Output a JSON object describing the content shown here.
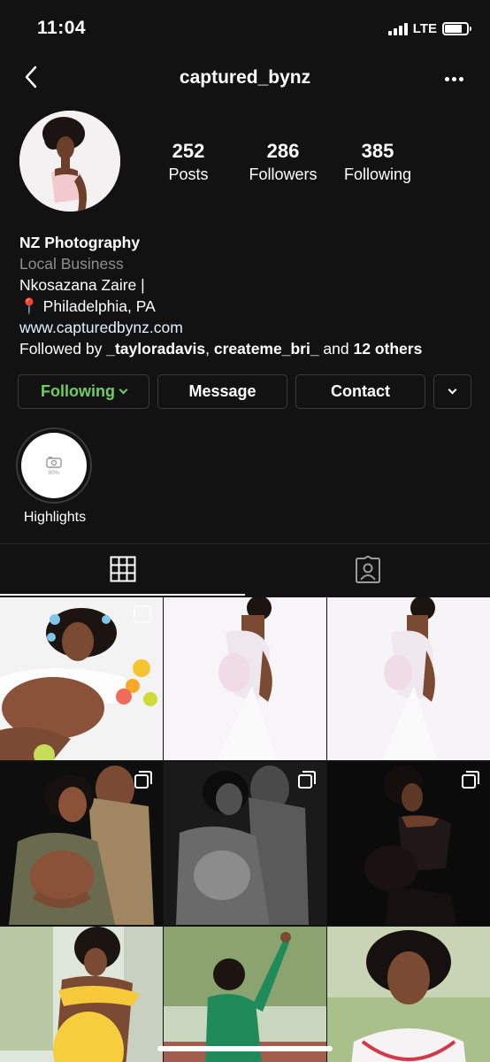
{
  "status_bar": {
    "time": "11:04",
    "network": "LTE"
  },
  "header": {
    "username": "captured_bynz"
  },
  "stats": [
    {
      "value": "252",
      "label": "Posts"
    },
    {
      "value": "286",
      "label": "Followers"
    },
    {
      "value": "385",
      "label": "Following"
    }
  ],
  "bio": {
    "name": "NZ Photography",
    "category": "Local Business",
    "line1": "Nkosazana Zaire |",
    "location_pin": "📍",
    "location": "Philadelphia, PA",
    "website": "www.capturedbynz.com",
    "followed_by_prefix": "Followed by ",
    "followed_user_1": "_tayloradavis",
    "followed_sep": ", ",
    "followed_user_2": "createme_bri_",
    "followed_and": " and ",
    "followed_others": "12 others"
  },
  "buttons": {
    "following": "Following",
    "message": "Message",
    "contact": "Contact"
  },
  "highlights": [
    {
      "label": "Highlights",
      "icon_text": "80%"
    }
  ],
  "tabs": [
    {
      "icon": "grid-icon",
      "active": true
    },
    {
      "icon": "tagged-icon",
      "active": false
    }
  ],
  "grid_posts": [
    {
      "subject": "maternity bath with flowers",
      "multiple": true
    },
    {
      "subject": "maternity white gown",
      "multiple": false
    },
    {
      "subject": "maternity white gown side",
      "multiple": false
    },
    {
      "subject": "couple in military uniform",
      "multiple": true
    },
    {
      "subject": "couple black and white",
      "multiple": true
    },
    {
      "subject": "maternity black dress",
      "multiple": true
    },
    {
      "subject": "maternity yellow dress outdoors",
      "multiple": false
    },
    {
      "subject": "green jacket raised fist",
      "multiple": false
    },
    {
      "subject": "portrait with stethoscope",
      "multiple": false
    }
  ],
  "colors": {
    "background": "#121212",
    "following_green": "#6fce62",
    "secondary_text": "#8e8e8e",
    "link": "#e0f1ff"
  }
}
